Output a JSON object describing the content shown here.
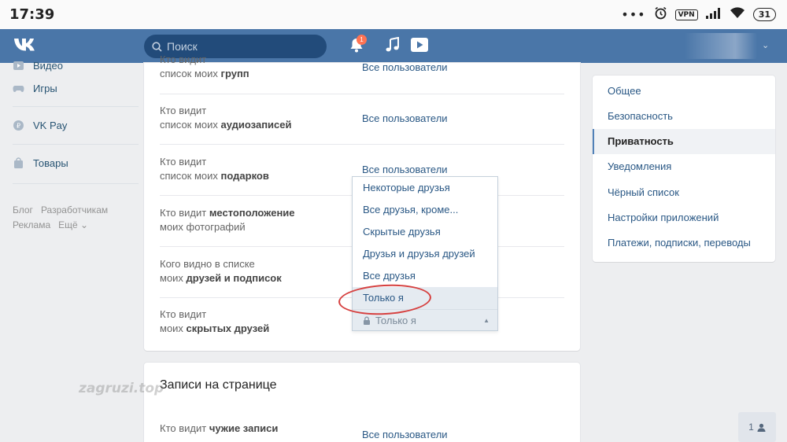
{
  "status_bar": {
    "time": "17:39",
    "vpn": "VPN",
    "battery": "31"
  },
  "header": {
    "search_placeholder": "Поиск",
    "notification_count": "1"
  },
  "left_menu": {
    "items": [
      {
        "label": "Видео",
        "icon": "video-icon"
      },
      {
        "label": "Игры",
        "icon": "gamepad-icon"
      },
      {
        "label": "VK Pay",
        "icon": "vkpay-icon"
      },
      {
        "label": "Товары",
        "icon": "shopping-bag-icon"
      }
    ],
    "footer_links": [
      "Блог",
      "Разработчикам",
      "Реклама",
      "Ещё ⌄"
    ]
  },
  "privacy_rows": [
    {
      "line1": "Кто видит",
      "line2_plain": "список моих ",
      "line2_bold": "групп",
      "value": "Все пользователи"
    },
    {
      "line1": "Кто видит",
      "line2_plain": "список моих ",
      "line2_bold": "аудиозаписей",
      "value": "Все пользователи"
    },
    {
      "line1": "Кто видит",
      "line2_plain": "список моих ",
      "line2_bold": "подарков",
      "value": "Все пользователи"
    },
    {
      "line1_plain": "Кто видит ",
      "line1_bold": "местоположение",
      "line2": "моих фотографий"
    },
    {
      "line1": "Кого видно в списке",
      "line2_plain": "моих ",
      "line2_bold": "друзей и подписок"
    },
    {
      "line1": "Кто видит",
      "line2_plain": "моих ",
      "line2_bold": "скрытых друзей"
    }
  ],
  "dropdown": {
    "options": [
      "Некоторые друзья",
      "Все друзья, кроме...",
      "Скрытые друзья",
      "Друзья и друзья друзей",
      "Все друзья",
      "Только я"
    ],
    "highlighted_index": 5,
    "current_value": "Только я"
  },
  "posts_section": {
    "title": "Записи на странице",
    "row": {
      "line1_plain": "Кто видит ",
      "line1_bold": "чужие записи",
      "value": "Все пользователи"
    }
  },
  "watermark": "zagruzi.top",
  "right_menu": {
    "items": [
      "Общее",
      "Безопасность",
      "Приватность",
      "Уведомления",
      "Чёрный список",
      "Настройки приложений",
      "Платежи, подписки, переводы"
    ],
    "active_index": 2
  },
  "friends_online": "1",
  "colors": {
    "header": "#4a76a8",
    "link": "#2a5885",
    "highlight": "#e5ebf1",
    "circle": "#d6403f"
  }
}
